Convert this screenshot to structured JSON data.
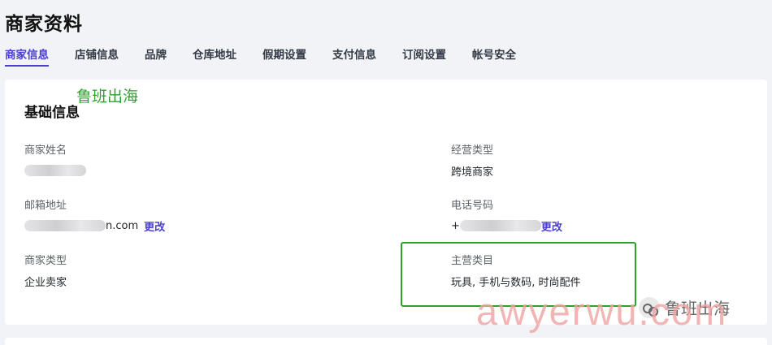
{
  "page": {
    "title": "商家资料"
  },
  "tabs": [
    {
      "label": "商家信息",
      "active": true
    },
    {
      "label": "店铺信息"
    },
    {
      "label": "品牌"
    },
    {
      "label": "仓库地址"
    },
    {
      "label": "假期设置"
    },
    {
      "label": "支付信息"
    },
    {
      "label": "订阅设置"
    },
    {
      "label": "帐号安全"
    }
  ],
  "watermark": {
    "top_text": "鲁班出海",
    "brand_text": "鲁班出海",
    "large_text": "awyerwu.com"
  },
  "section": {
    "title": "基础信息"
  },
  "fields": {
    "merchant_name": {
      "label": "商家姓名",
      "value": ""
    },
    "business_type": {
      "label": "经营类型",
      "value": "跨境商家"
    },
    "email": {
      "label": "邮箱地址",
      "value_suffix": "n.com",
      "edit_label": "更改"
    },
    "phone": {
      "label": "电话号码",
      "value_prefix": "+",
      "edit_label": "更改"
    },
    "merchant_type": {
      "label": "商家类型",
      "value": "企业卖家"
    },
    "main_category": {
      "label": "主营类目",
      "value": "玩具, 手机与数码, 时尚配件"
    }
  },
  "colors": {
    "accent": "#4a3fcf",
    "highlight": "#2ea02e",
    "watermark": "#f0a3a3"
  }
}
